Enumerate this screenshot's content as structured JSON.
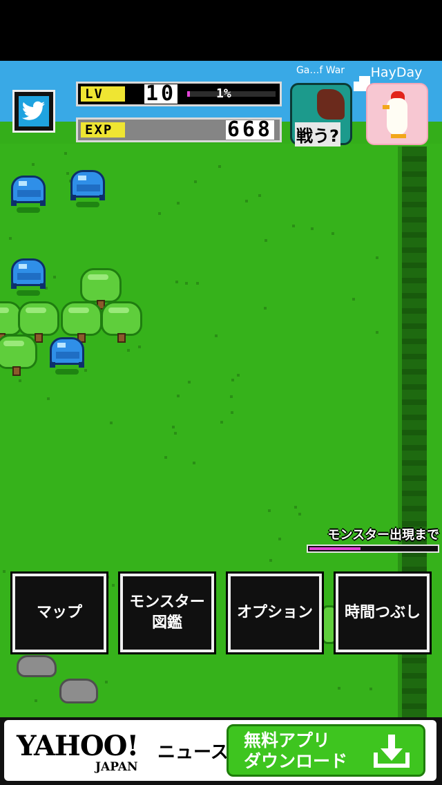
{
  "hud": {
    "lv_tag": "LV",
    "lv_value": "10",
    "lv_percent": "1%",
    "lv_progress": 0.01,
    "exp_tag": "EXP",
    "exp_value": "668"
  },
  "ads": {
    "left_label": "Ga…f War",
    "left_icon_text": "戦う?",
    "right_label": "HayDay"
  },
  "spawn": {
    "label": "モンスター出現まで",
    "progress": 0.4
  },
  "menu": [
    {
      "label": "マップ"
    },
    {
      "label": "モンスター\n図鑑"
    },
    {
      "label": "オプション"
    },
    {
      "label": "時間つぶし"
    }
  ],
  "banner": {
    "logo": "YAHOO!",
    "logo_sub": "JAPAN",
    "service": "ニュース",
    "cta": "無料アプリ\nダウンロード"
  },
  "colors": {
    "sky": "#39a9e6",
    "grass": "#36b21b",
    "accent_magenta": "#e243d7",
    "tag_yellow": "#efe532",
    "cta_green": "#3ec51f"
  }
}
